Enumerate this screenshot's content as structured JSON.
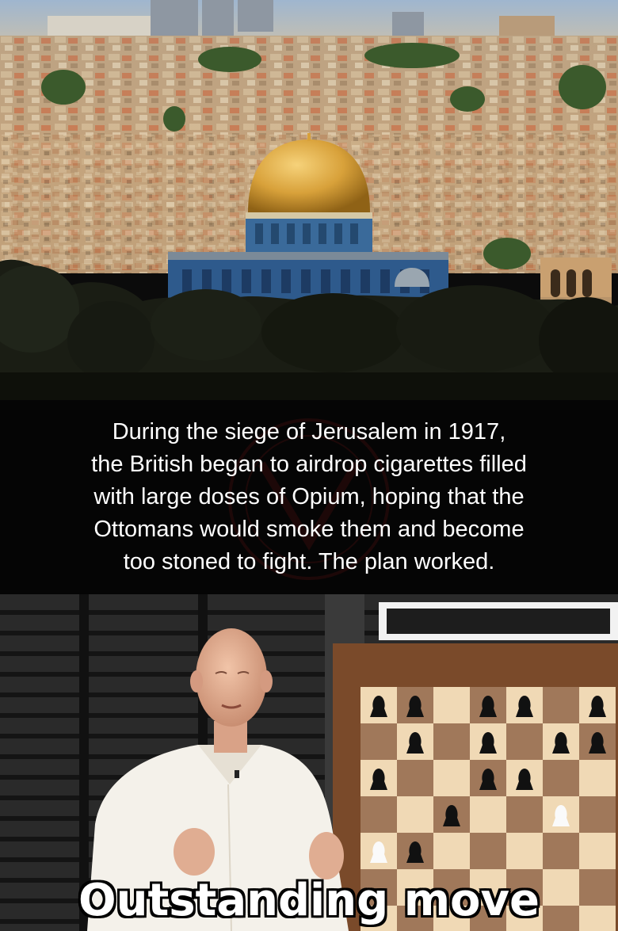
{
  "caption": {
    "lines": [
      "During the siege of Jerusalem in 1917,",
      "the British began to airdrop cigarettes filled",
      "with large doses of Opium, hoping that the",
      "Ottomans would smoke them and become",
      "too stoned to fight. The plan worked."
    ]
  },
  "bottom_caption": "Outstanding move",
  "colors": {
    "dome_gold": "#d8a13a",
    "tile_blue": "#2e5a8c",
    "sky": "#9fb3c8",
    "stone": "#c9a77f",
    "board_light": "#f0d9b5",
    "board_dark": "#a0785a",
    "shirt": "#f4f1ea"
  }
}
